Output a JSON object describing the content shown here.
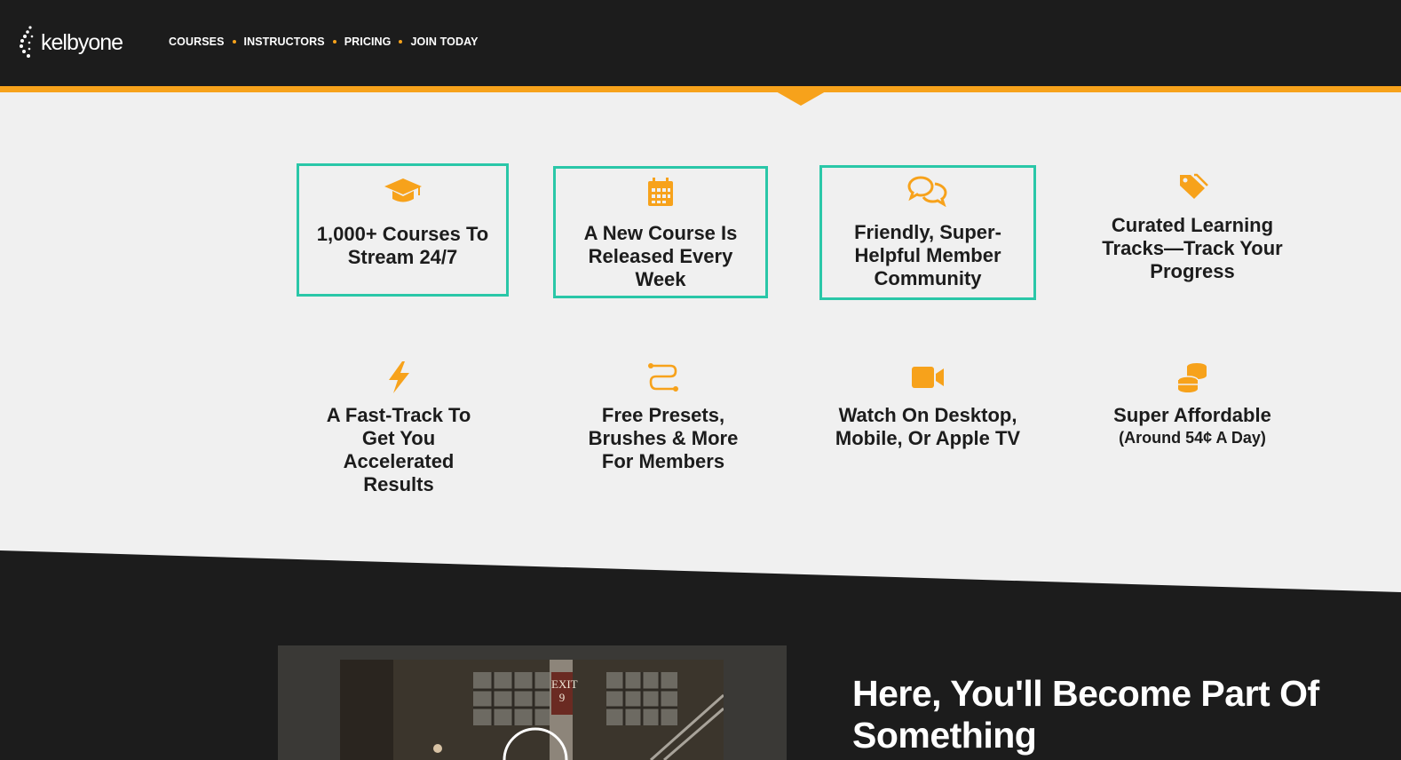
{
  "brand": {
    "logo_text": "kelbyone",
    "accent": "#f7a21b",
    "teal": "#2ac7a8",
    "dark": "#1c1c1c"
  },
  "nav": {
    "items": [
      "COURSES",
      "INSTRUCTORS",
      "PRICING",
      "JOIN TODAY"
    ]
  },
  "features": [
    {
      "icon": "graduation-cap-icon",
      "title": "1,000+ Courses To Stream 24/7"
    },
    {
      "icon": "calendar-icon",
      "title": "A New Course Is Released Every Week"
    },
    {
      "icon": "chat-bubbles-icon",
      "title": "Friendly, Super-Helpful Member Community"
    },
    {
      "icon": "tags-icon",
      "title": "Curated Learning Tracks—Track Your Progress"
    },
    {
      "icon": "lightning-bolt-icon",
      "title": "A Fast-Track To Get You Accelerated Results"
    },
    {
      "icon": "route-icon",
      "title": "Free Presets, Brushes & More For Members"
    },
    {
      "icon": "video-camera-icon",
      "title": "Watch On Desktop, Mobile, Or Apple TV"
    },
    {
      "icon": "coins-icon",
      "title": "Super Affordable",
      "subtitle": "(Around 54¢ A Day)"
    }
  ],
  "video": {
    "sign_text": "EXIT 9"
  },
  "headline": "Here, You'll Become Part Of Something"
}
